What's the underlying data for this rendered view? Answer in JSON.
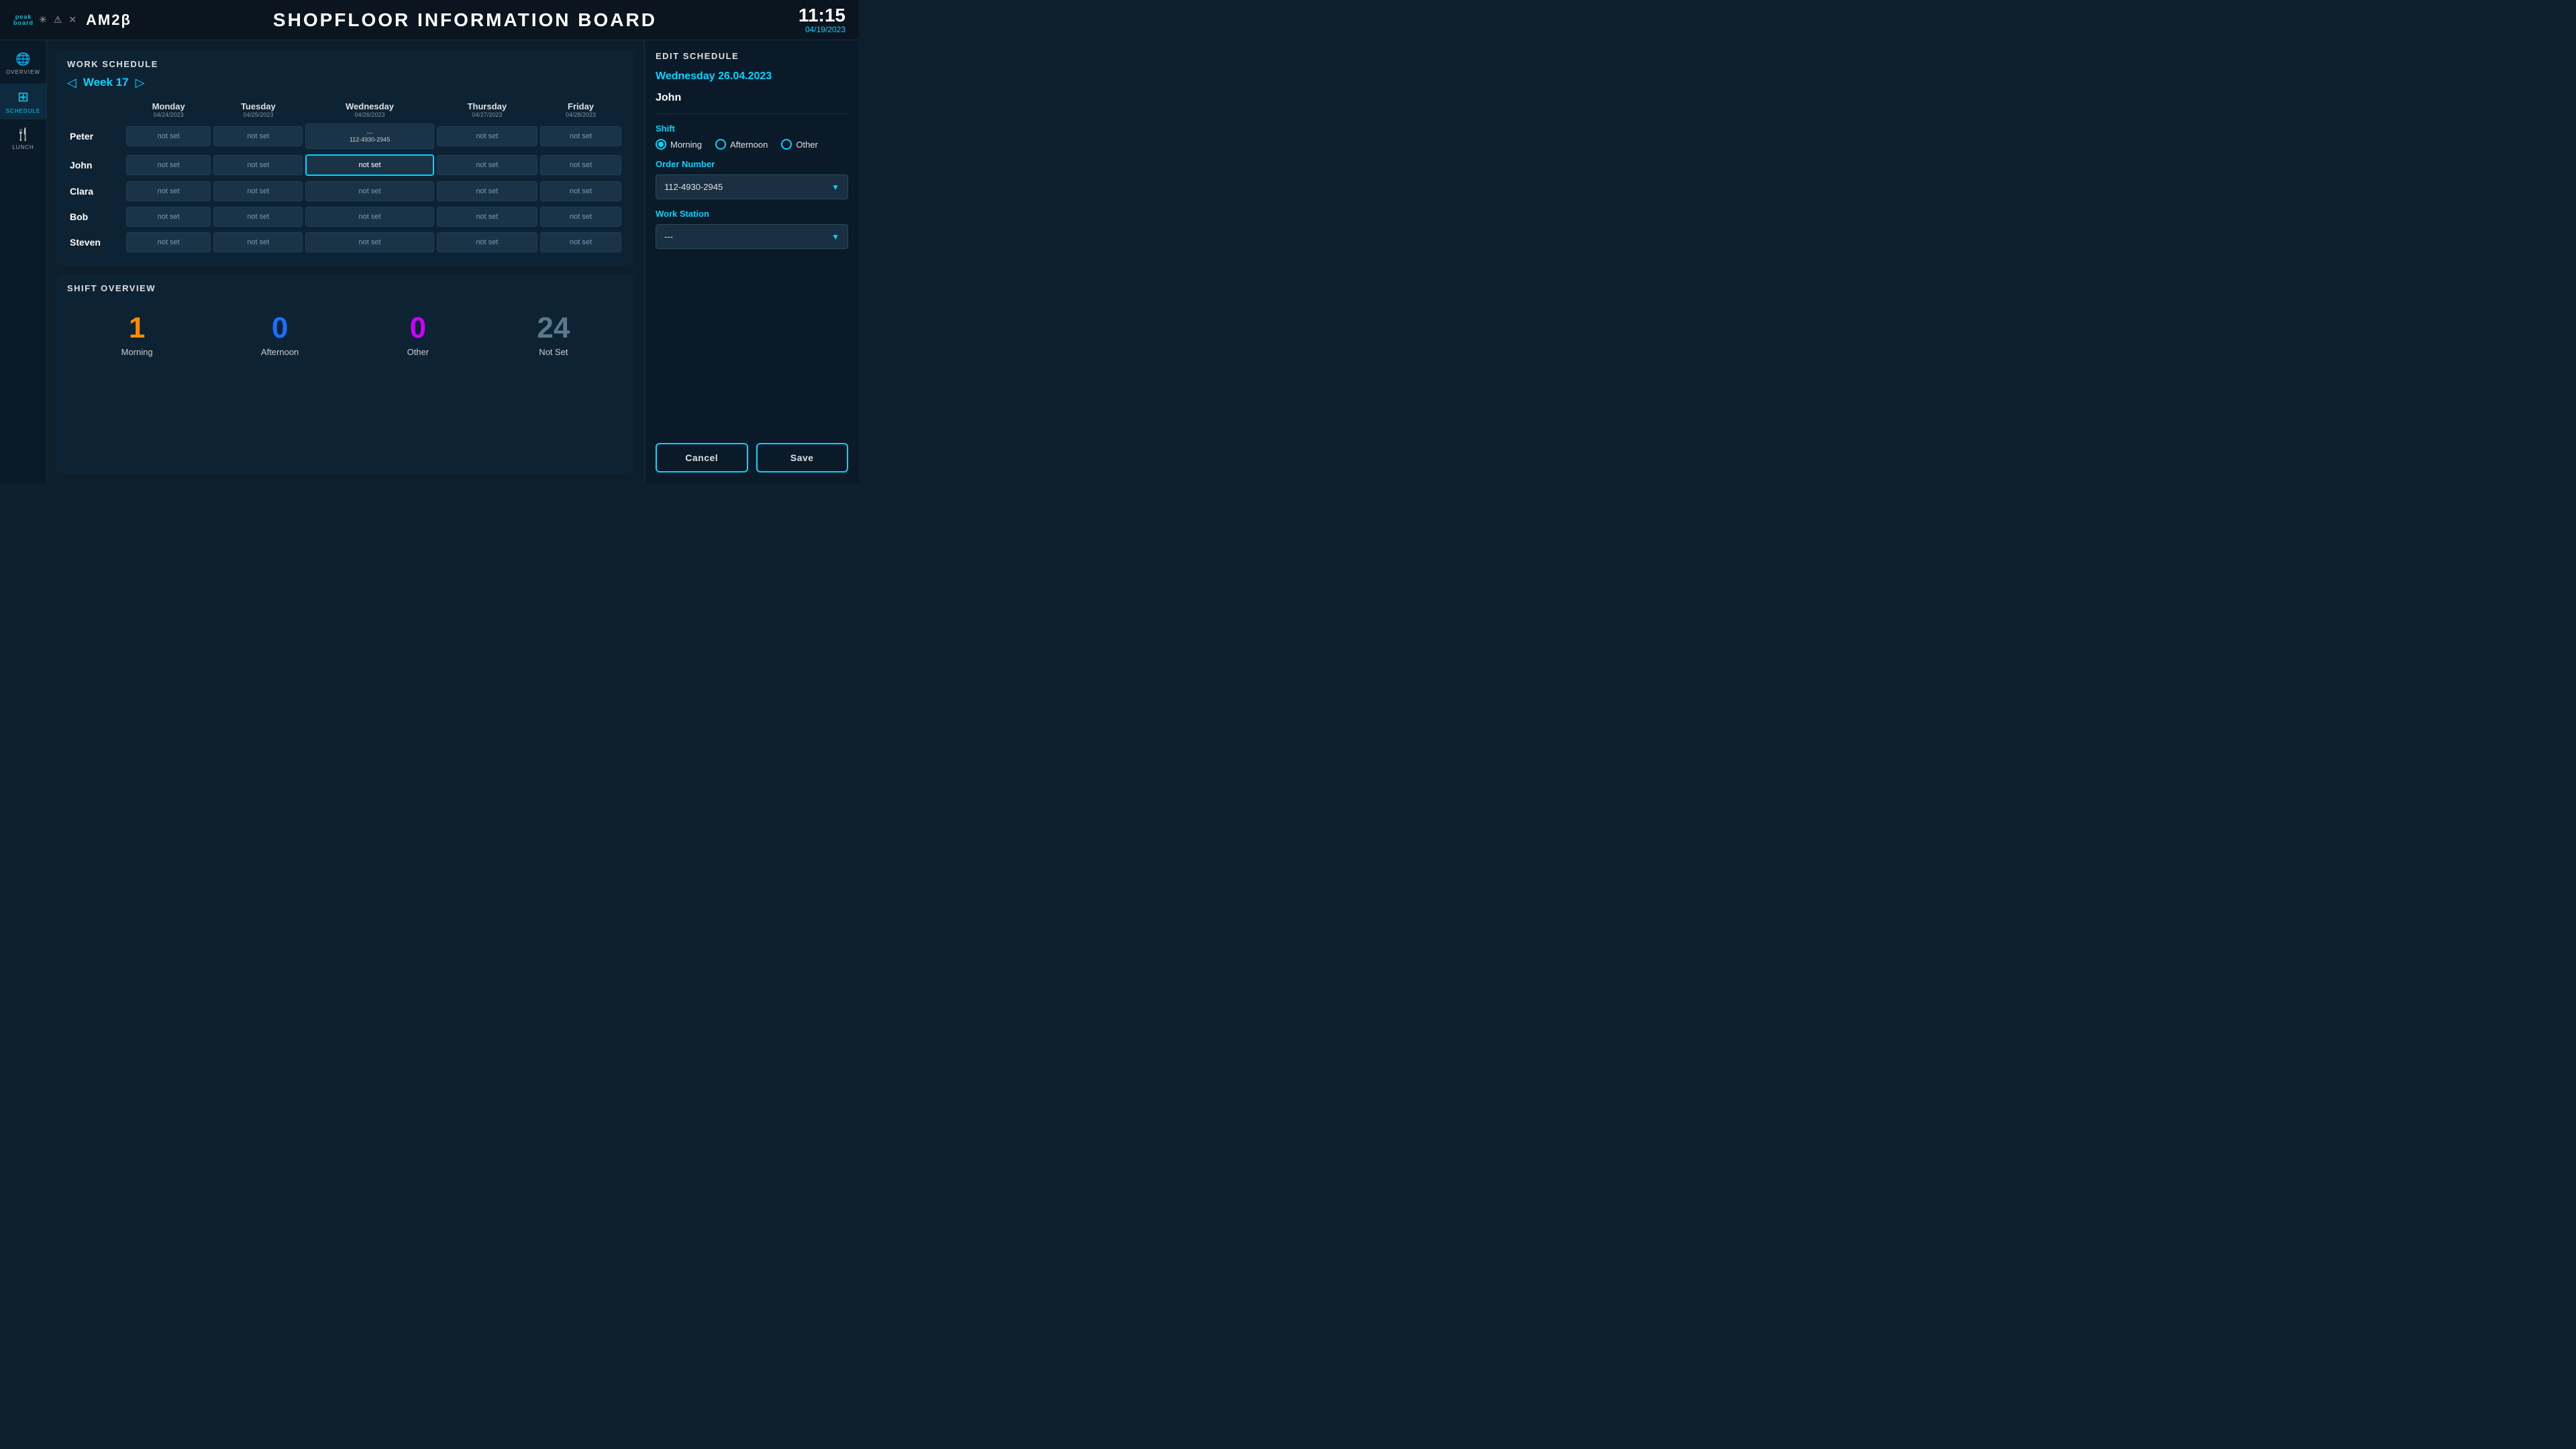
{
  "header": {
    "logo": "peak\nboard",
    "brand": "AM2β",
    "title": "SHOPFLOOR INFORMATION BOARD",
    "time": "11:15",
    "date": "04/19/2023",
    "icons": [
      "asterisk",
      "warning",
      "close"
    ]
  },
  "sidebar": {
    "items": [
      {
        "id": "overview",
        "label": "OVERVIEW",
        "icon": "🌐",
        "active": false
      },
      {
        "id": "schedule",
        "label": "SCHEDULE",
        "icon": "▦",
        "active": true
      },
      {
        "id": "lunch",
        "label": "LUNCH",
        "icon": "🍴",
        "active": false
      }
    ]
  },
  "work_schedule": {
    "section_title": "WORK SCHEDULE",
    "week_label": "Week 17",
    "columns": [
      {
        "day": "Monday",
        "date": "04/24/2023"
      },
      {
        "day": "Tuesday",
        "date": "04/25/2023"
      },
      {
        "day": "Wednesday",
        "date": "04/26/2023"
      },
      {
        "day": "Thursday",
        "date": "04/27/2023"
      },
      {
        "day": "Friday",
        "date": "04/28/2023"
      }
    ],
    "rows": [
      {
        "name": "Peter",
        "cells": [
          {
            "value": "not set",
            "active": false,
            "has_data": false
          },
          {
            "value": "not set",
            "active": false,
            "has_data": false
          },
          {
            "value": "---\n112-4930-2945",
            "active": false,
            "has_data": true
          },
          {
            "value": "not set",
            "active": false,
            "has_data": false
          },
          {
            "value": "not set",
            "active": false,
            "has_data": false
          }
        ]
      },
      {
        "name": "John",
        "cells": [
          {
            "value": "not set",
            "active": false,
            "has_data": false
          },
          {
            "value": "not set",
            "active": false,
            "has_data": false
          },
          {
            "value": "not set",
            "active": true,
            "has_data": false
          },
          {
            "value": "not set",
            "active": false,
            "has_data": false
          },
          {
            "value": "not set",
            "active": false,
            "has_data": false
          }
        ]
      },
      {
        "name": "Clara",
        "cells": [
          {
            "value": "not set",
            "active": false,
            "has_data": false
          },
          {
            "value": "not set",
            "active": false,
            "has_data": false
          },
          {
            "value": "not set",
            "active": false,
            "has_data": false
          },
          {
            "value": "not set",
            "active": false,
            "has_data": false
          },
          {
            "value": "not set",
            "active": false,
            "has_data": false
          }
        ]
      },
      {
        "name": "Bob",
        "cells": [
          {
            "value": "not set",
            "active": false,
            "has_data": false
          },
          {
            "value": "not set",
            "active": false,
            "has_data": false
          },
          {
            "value": "not set",
            "active": false,
            "has_data": false
          },
          {
            "value": "not set",
            "active": false,
            "has_data": false
          },
          {
            "value": "not set",
            "active": false,
            "has_data": false
          }
        ]
      },
      {
        "name": "Steven",
        "cells": [
          {
            "value": "not set",
            "active": false,
            "has_data": false
          },
          {
            "value": "not set",
            "active": false,
            "has_data": false
          },
          {
            "value": "not set",
            "active": false,
            "has_data": false
          },
          {
            "value": "not set",
            "active": false,
            "has_data": false
          },
          {
            "value": "not set",
            "active": false,
            "has_data": false
          }
        ]
      }
    ]
  },
  "shift_overview": {
    "section_title": "SHIFT OVERVIEW",
    "stats": [
      {
        "id": "morning",
        "value": "1",
        "label": "Morning",
        "color": "#ff8c00"
      },
      {
        "id": "afternoon",
        "value": "0",
        "label": "Afternoon",
        "color": "#1a6fff"
      },
      {
        "id": "other",
        "value": "0",
        "label": "Other",
        "color": "#cc00ff"
      },
      {
        "id": "notset",
        "value": "24",
        "label": "Not Set",
        "color": "#5a7a8a"
      }
    ]
  },
  "edit_schedule": {
    "section_title": "EDIT SCHEDULE",
    "date": "Wednesday   26.04.2023",
    "person": "John",
    "shift_label": "Shift",
    "shift_options": [
      {
        "id": "morning",
        "label": "Morning",
        "checked": true
      },
      {
        "id": "afternoon",
        "label": "Afternoon",
        "checked": false
      },
      {
        "id": "other",
        "label": "Other",
        "checked": false
      }
    ],
    "order_number_label": "Order Number",
    "order_number_value": "112-4930-2945",
    "order_number_dropdown_placeholder": "112-4930-2945",
    "workstation_label": "Work Station",
    "workstation_placeholder": "---",
    "cancel_label": "Cancel",
    "save_label": "Save"
  }
}
